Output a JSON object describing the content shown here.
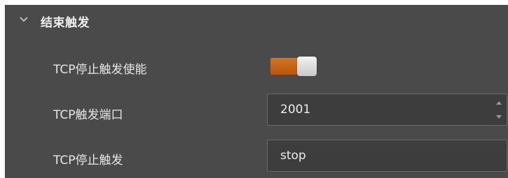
{
  "section": {
    "title": "结束触发",
    "expanded_icon": "chevron-down-icon"
  },
  "rows": [
    {
      "label": "TCP停止触发使能",
      "control": "toggle",
      "enabled": true,
      "accent": "#d06b18"
    },
    {
      "label": "TCP触发端口",
      "control": "number",
      "value": "2001"
    },
    {
      "label": "TCP停止触发",
      "control": "text",
      "value": "stop"
    }
  ],
  "icons": {
    "spin_up": "caret-up-icon",
    "spin_down": "caret-down-icon"
  }
}
